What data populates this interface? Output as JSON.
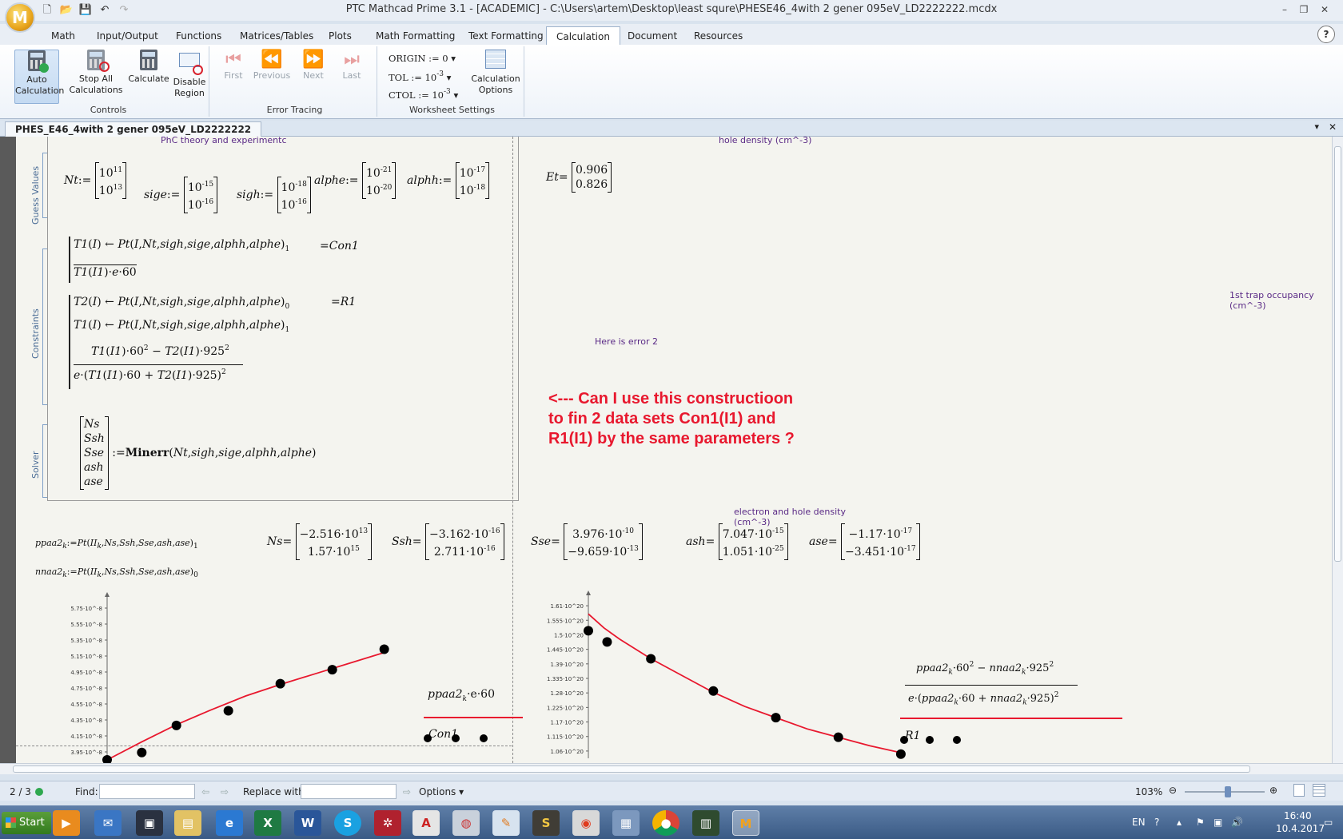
{
  "window": {
    "title": "PTC Mathcad Prime 3.1 - [ACADEMIC] - C:\\Users\\artem\\Desktop\\least squre\\PHESE46_4with 2 gener 095eV_LD2222222.mcdx",
    "logo_letter": "M"
  },
  "ribbon_tabs": [
    "Math",
    "Input/Output",
    "Functions",
    "Matrices/Tables",
    "Plots",
    "Math Formatting",
    "Text Formatting",
    "Calculation",
    "Document",
    "Resources"
  ],
  "help_label": "?",
  "ribbon": {
    "controls": {
      "label": "Controls",
      "auto_calc": "Auto Calculation",
      "stop_all": "Stop All Calculations",
      "calculate": "Calculate",
      "disable": "Disable Region"
    },
    "error_tracing": {
      "label": "Error Tracing",
      "first": "First",
      "previous": "Previous",
      "next": "Next",
      "last": "Last"
    },
    "worksheet_settings": {
      "label": "Worksheet Settings",
      "origin": "ORIGIN := 0",
      "tol": "TOL := 10",
      "tol_exp": "-3",
      "ctol": "CTOL := 10",
      "ctol_exp": "-3",
      "calc_options": "Calculation Options"
    }
  },
  "document_tab": "PHES_E46_4with 2 gener 095eV_LD2222222",
  "worksheet": {
    "notes": {
      "phc": "PhC theory and experimentc",
      "hole_density": "hole density (cm^-3)",
      "trap_occupancy": "1st trap occupancy (cm^-3)",
      "error2": "Here is error 2",
      "eh_density_1": "electron and hole density",
      "eh_density_2": "(cm^-3)"
    },
    "solve_tags": {
      "guess": "Guess Values",
      "constraints": "Constraints",
      "solver": "Solver"
    },
    "question": [
      "<--- Can I use this constructioon",
      "to fin 2 data sets Con1(I1) and",
      "R1(I1) by the same parameters ?"
    ],
    "guess": {
      "Nt": [
        "10",
        "11",
        "10",
        "13"
      ],
      "sige": [
        "10",
        "-15",
        "10",
        "-16"
      ],
      "sigh": [
        "10",
        "-18",
        "10",
        "-16"
      ],
      "alphe": [
        "10",
        "-21",
        "10",
        "-20"
      ],
      "alphh": [
        "10",
        "-17",
        "10",
        "-18"
      ],
      "Et": [
        "0.906",
        "0.826"
      ]
    },
    "results": {
      "Ns": [
        "−2.516·10",
        "13",
        "1.57·10",
        "15"
      ],
      "Ssh": [
        "−3.162·10",
        "-16",
        "2.711·10",
        "-16"
      ],
      "Sse": [
        "3.976·10",
        "-10",
        "−9.659·10",
        "-13"
      ],
      "ash": [
        "7.047·10",
        "-15",
        "1.051·10",
        "-25"
      ],
      "ase": [
        "−1.17·10",
        "-17",
        "−3.451·10",
        "-17"
      ]
    },
    "plot_labels": {
      "left_y": "ppaa2",
      "left_y_rest": "·e·60",
      "left_x": "Con1",
      "right_x": "R1"
    }
  },
  "statusbar": {
    "page": "2 / 3",
    "find": "Find:",
    "replace": "Replace with:",
    "options": "Options",
    "zoom": "103%"
  },
  "taskbar": {
    "start": "Start",
    "lang": "EN",
    "time": "16:40",
    "date": "10.4.2017"
  },
  "chart_data": [
    {
      "type": "scatter",
      "title": "",
      "xlabel": "",
      "ylabel": "ppaa2·e·60",
      "yticks": [
        "3.95·10^-8",
        "4.15·10^-8",
        "4.35·10^-8",
        "4.55·10^-8",
        "4.75·10^-8",
        "4.95·10^-8",
        "5.15·10^-8",
        "5.35·10^-8",
        "5.55·10^-8",
        "5.75·10^-8"
      ],
      "ylim": [
        3.85e-08,
        5.8e-08
      ],
      "xlim": [
        0,
        12
      ],
      "series": [
        {
          "kind": "points",
          "x": [
            0,
            1,
            2,
            3.5,
            5,
            6.5,
            8
          ],
          "y": [
            3.85e-08,
            3.94e-08,
            4.27e-08,
            4.45e-08,
            4.78e-08,
            4.95e-08,
            5.2e-08
          ]
        },
        {
          "kind": "fit",
          "x": [
            0,
            1,
            2,
            3,
            4,
            5,
            6,
            7,
            8
          ],
          "y": [
            3.85e-08,
            4.07e-08,
            4.28e-08,
            4.46e-08,
            4.63e-08,
            4.77e-08,
            4.9e-08,
            5.03e-08,
            5.16e-08
          ]
        }
      ],
      "grid": false
    },
    {
      "type": "scatter",
      "title": "",
      "xlabel": "",
      "ylabel": "",
      "yticks": [
        "1.06·10^20",
        "1.115·10^20",
        "1.17·10^20",
        "1.225·10^20",
        "1.28·10^20",
        "1.335·10^20",
        "1.39·10^20",
        "1.445·10^20",
        "1.5·10^20",
        "1.555·10^20",
        "1.61·10^20"
      ],
      "ylim": [
        1.045e+20,
        1.615e+20
      ],
      "xlim": [
        0,
        11
      ],
      "series": [
        {
          "kind": "points",
          "x": [
            0,
            0.6,
            2,
            4,
            6,
            8,
            10
          ],
          "y": [
            1.5e+20,
            1.46e+20,
            1.4e+20,
            1.285e+20,
            1.19e+20,
            1.12e+20,
            1.06e+20
          ]
        },
        {
          "kind": "fit",
          "x": [
            0,
            0.5,
            1,
            2,
            3,
            4,
            5,
            6,
            7,
            8,
            9,
            10
          ],
          "y": [
            1.56e+20,
            1.51e+20,
            1.47e+20,
            1.4e+20,
            1.34e+20,
            1.28e+20,
            1.23e+20,
            1.19e+20,
            1.15e+20,
            1.12e+20,
            1.09e+20,
            1.065e+20
          ]
        }
      ],
      "grid": false
    }
  ]
}
